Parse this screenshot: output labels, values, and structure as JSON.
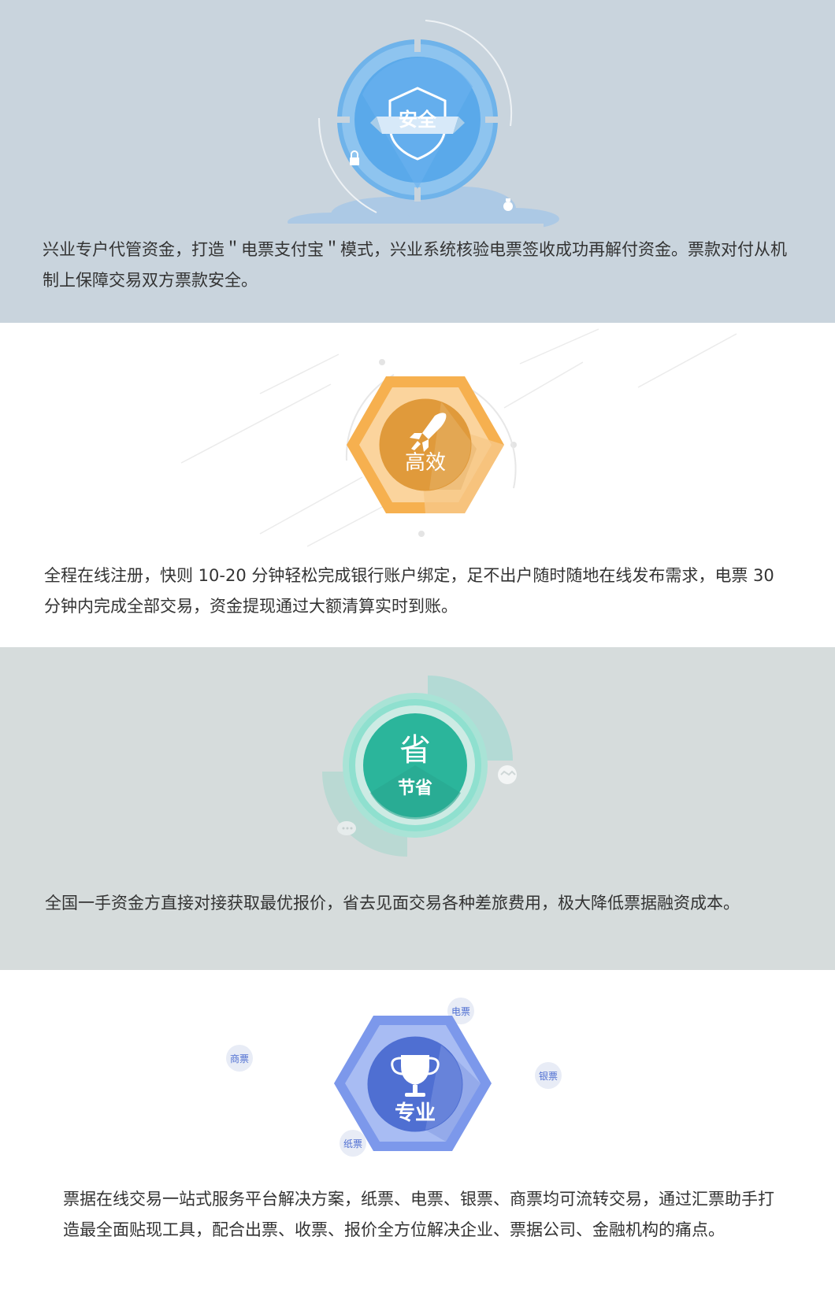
{
  "sections": [
    {
      "badge": "安全",
      "description": "兴业专户代管资金，打造＂电票支付宝＂模式，兴业系统核验电票签收成功再解付资金。票款对付从机制上保障交易双方票款安全。"
    },
    {
      "badge": "高效",
      "description": "全程在线注册，快则 10-20 分钟轻松完成银行账户绑定，足不出户随时随地在线发布需求，电票 30 分钟内完成全部交易，资金提现通过大额清算实时到账。"
    },
    {
      "badge_glyph": "省",
      "badge": "节省",
      "description": "全国一手资金方直接对接获取最优报价，省去见面交易各种差旅费用，极大降低票据融资成本。"
    },
    {
      "badge": "专业",
      "tags": [
        "电票",
        "商票",
        "银票",
        "纸票"
      ],
      "description": "票据在线交易一站式服务平台解决方案，纸票、电票、银票、商票均可流转交易，通过汇票助手打造最全面贴现工具，配合出票、收票、报价全方位解决企业、票据公司、金融机构的痛点。"
    }
  ],
  "colors": {
    "safe_bg": "#c9d4dd",
    "safe_blue": "#5aa9ea",
    "efficient_orange": "#f6b04f",
    "efficient_core": "#e09a3b",
    "save_bg": "#d6dcdc",
    "save_green": "#2bb59b",
    "pro_blue": "#4f6fd2"
  },
  "icons": [
    "shield-icon",
    "lock-icon",
    "moneybag-icon",
    "rocket-icon",
    "handshake-icon",
    "chat-icon",
    "trophy-icon"
  ]
}
